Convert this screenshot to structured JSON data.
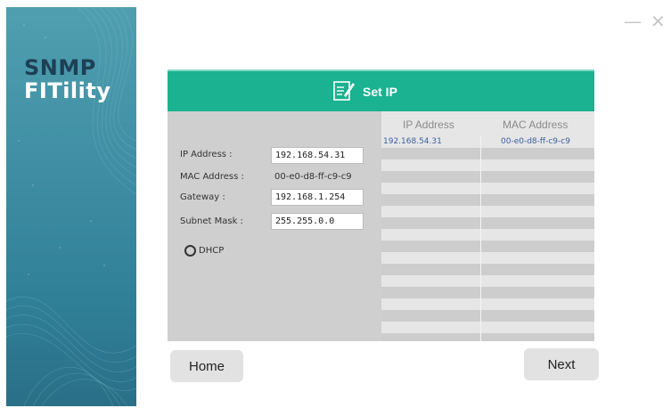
{
  "app": {
    "brand_line1": "SNMP",
    "brand_line2": "FITility",
    "accent_color": "#1ab290",
    "sidebar_color": "#3f8ea3"
  },
  "window_controls": {
    "minimize_label": "—",
    "close_label": "✕"
  },
  "dialog": {
    "title": "Set IP",
    "header_icon": "edit-form-icon"
  },
  "form": {
    "ip_label": "IP Address :",
    "ip_value": "192.168.54.31",
    "mac_label": "MAC Address :",
    "mac_value": "00-e0-d8-ff-c9-c9",
    "gateway_label": "Gateway :",
    "gateway_value": "192.168.1.254",
    "subnet_label": "Subnet Mask :",
    "subnet_value": "255.255.0.0",
    "dhcp_label": "DHCP"
  },
  "device_table": {
    "headers": [
      "IP Address",
      "MAC Address"
    ],
    "rows": [
      {
        "ip": "192.168.54.31",
        "mac": "00-e0-d8-ff-c9-c9"
      }
    ]
  },
  "buttons": {
    "home": "Home",
    "next": "Next"
  }
}
